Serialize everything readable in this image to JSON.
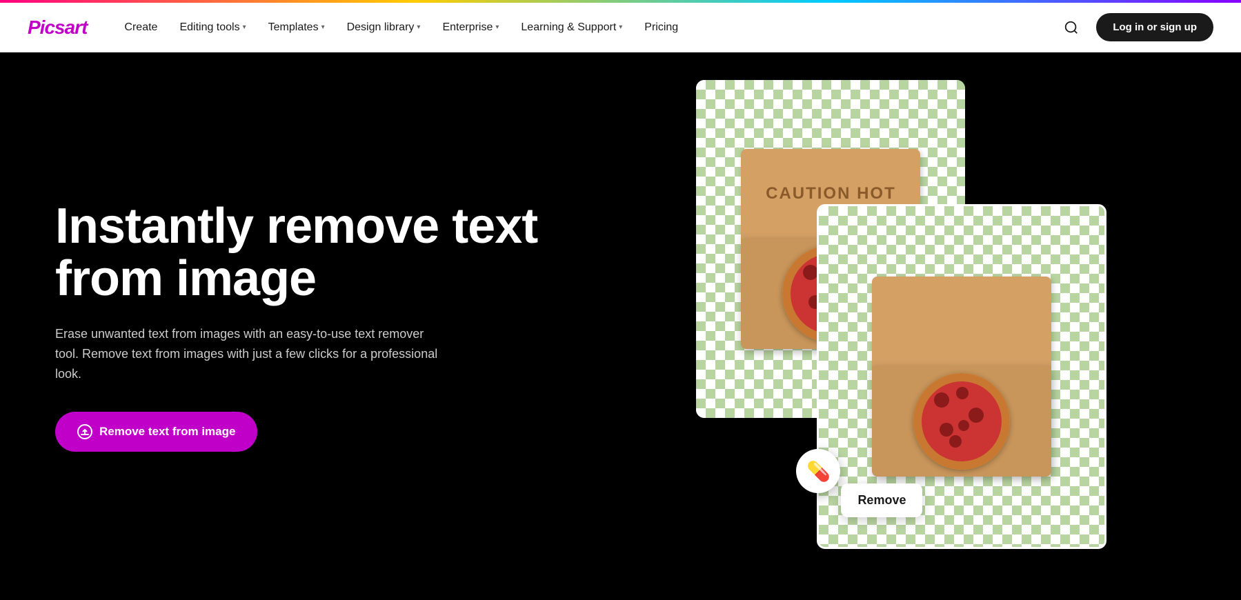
{
  "topBar": {},
  "header": {
    "logo": "Picsart",
    "nav": {
      "create": "Create",
      "editingTools": "Editing tools",
      "templates": "Templates",
      "designLibrary": "Design library",
      "enterprise": "Enterprise",
      "learningSupport": "Learning & Support",
      "pricing": "Pricing"
    },
    "loginBtn": "Log in or sign up"
  },
  "hero": {
    "title": "Instantly remove text from image",
    "subtitle": "Erase unwanted text from images with an easy-to-use text remover tool. Remove text from images with just a few clicks for a professional look.",
    "ctaBtn": "Remove text from image",
    "pizzaLidText": "CAUTION HOT",
    "removeTooltip": "Remove"
  }
}
